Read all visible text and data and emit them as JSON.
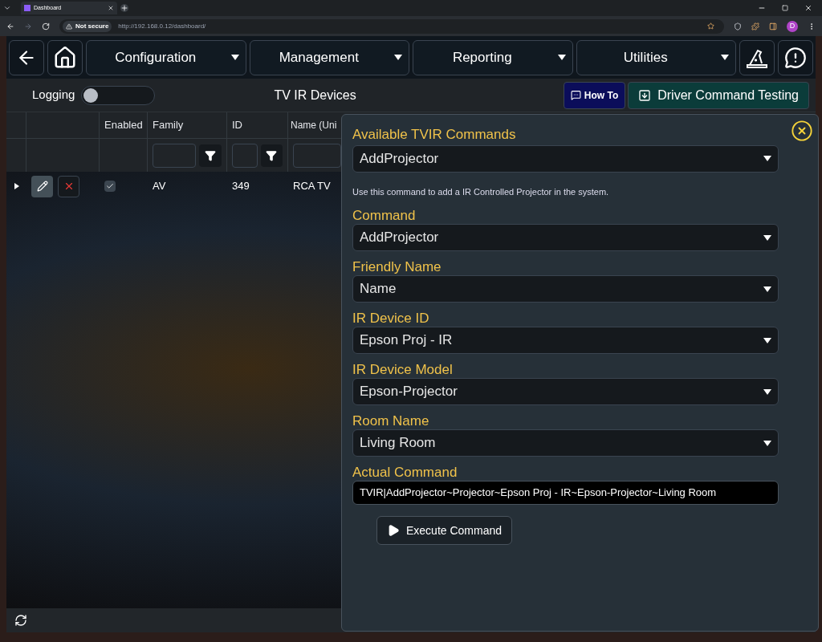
{
  "browser": {
    "tab_title": "Dashboard",
    "security": "Not secure",
    "url": "http://192.168.0.12/dashboard/",
    "profile": "D"
  },
  "nav": {
    "menus": [
      "Configuration",
      "Management",
      "Reporting",
      "Utilities"
    ]
  },
  "toolbar": {
    "logging_label": "Logging",
    "logging_on": false,
    "title": "TV IR Devices",
    "how_to": "How To",
    "testing": "Driver Command Testing"
  },
  "table": {
    "columns": [
      "Enabled",
      "Family",
      "ID",
      "Name (Uni"
    ],
    "rows": [
      {
        "enabled": true,
        "family": "AV",
        "id": "349",
        "name": "RCA TV"
      }
    ]
  },
  "panel": {
    "available_label": "Available TVIR Commands",
    "available_value": "AddProjector",
    "description": "Use this command to add a IR Controlled Projector in the system.",
    "fields": [
      {
        "label": "Command",
        "value": "AddProjector"
      },
      {
        "label": "Friendly Name",
        "value": "Name"
      },
      {
        "label": "IR Device ID",
        "value": "Epson Proj - IR"
      },
      {
        "label": "IR Device Model",
        "value": "Epson-Projector"
      },
      {
        "label": "Room Name",
        "value": "Living Room"
      }
    ],
    "actual_label": "Actual Command",
    "actual_value": "TVIR|AddProjector~Projector~Epson Proj - IR~Epson-Projector~Living Room",
    "execute": "Execute Command"
  }
}
